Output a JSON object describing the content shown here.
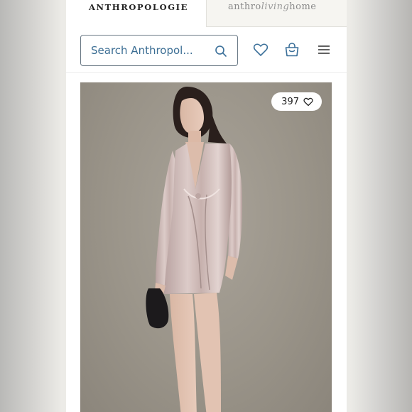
{
  "brand_tabs": {
    "anthropologie": "ANTHROPOLOGIE",
    "living_prefix": "anthro",
    "living_script": "living",
    "living_suffix": "home"
  },
  "header": {
    "search_placeholder": "Search Anthropol...",
    "icons": [
      "search-icon",
      "heart-icon",
      "bag-icon",
      "menu-icon"
    ]
  },
  "product": {
    "like_count": "397",
    "image_subject": "model in blush pink satin long-sleeve twist-front mini dress holding black clutch"
  },
  "colors": {
    "accent": "#3c6e94",
    "icon": "#3a6f99",
    "photo_background": "#9a9489",
    "dress": "#cdb9b6"
  }
}
